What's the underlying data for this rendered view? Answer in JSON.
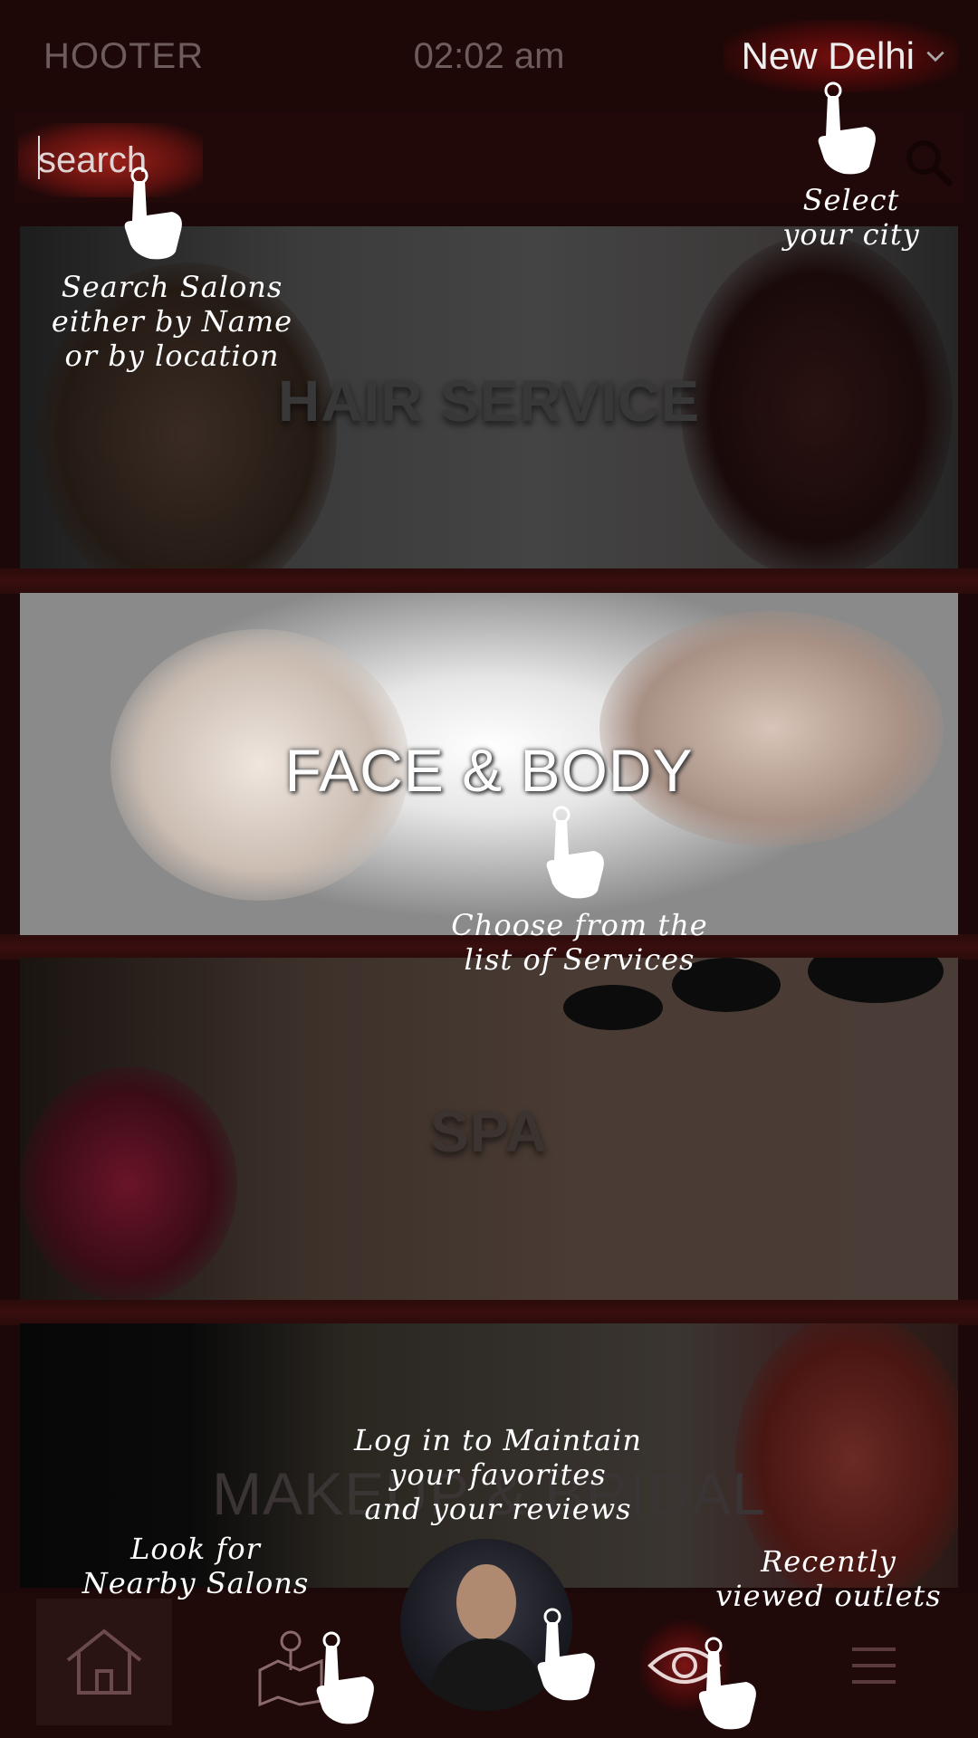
{
  "header": {
    "brand": "HOOTER",
    "time": "02:02 am",
    "city": "New Delhi"
  },
  "search": {
    "placeholder": "search"
  },
  "services": [
    {
      "title": "HAIR SERVICE"
    },
    {
      "title": "FACE & BODY"
    },
    {
      "title": "SPA"
    },
    {
      "title": "MAKEUP & BRIDAL"
    }
  ],
  "hints": {
    "city": "Select\nyour city",
    "search": "Search Salons\neither by Name\nor by location",
    "services": "Choose from the\nlist of Services",
    "login": "Log in to Maintain\nyour favorites\nand your reviews",
    "nearby": "Look for\nNearby Salons",
    "recent": "Recently\nviewed outlets"
  },
  "icons": {
    "home": "home-icon",
    "map": "map-pin-icon",
    "recent": "eye-icon",
    "menu": "hamburger-menu-icon",
    "search": "search-icon",
    "chevron": "chevron-down-icon",
    "pointer": "pointer-hand-icon"
  },
  "colors": {
    "background": "#1c0808",
    "accent_glow": "#c41e1e",
    "muted_text": "#6e5c5c",
    "hint_text": "#ffffff"
  }
}
